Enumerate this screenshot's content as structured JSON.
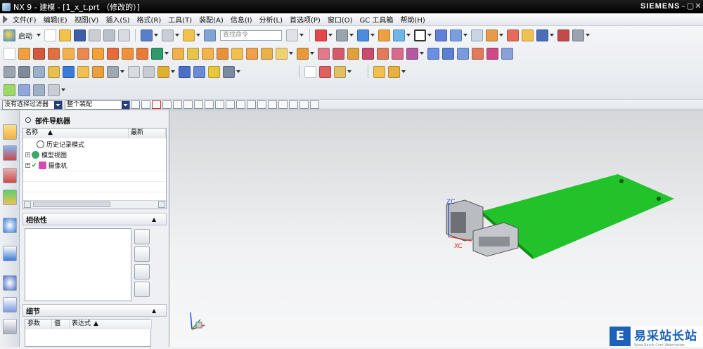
{
  "app": {
    "title": "NX 9 - 建模 - [1_x_t.prt （修改的）]",
    "brand": "SIEMENS",
    "window_buttons": [
      "–",
      "▢",
      "✕"
    ]
  },
  "menu": {
    "items": [
      "文件(F)",
      "编辑(E)",
      "视图(V)",
      "插入(S)",
      "格式(R)",
      "工具(T)",
      "装配(A)",
      "信息(I)",
      "分析(L)",
      "首选项(P)",
      "窗口(O)",
      "GC 工具箱",
      "帮助(H)"
    ]
  },
  "toolbar": {
    "start_label": "启动",
    "command_search_placeholder": "查找命令"
  },
  "filterbar": {
    "type_filter": "没有选择过滤器",
    "scope": "整个装配"
  },
  "navigator": {
    "title": "部件导航器",
    "col_name": "名称",
    "col_latest": "最新",
    "nodes": [
      "历史记录模式",
      "模型视图",
      "摄像机"
    ]
  },
  "dependencies": {
    "title": "相依性"
  },
  "details": {
    "title": "细节",
    "col_param": "参数",
    "col_value": "值",
    "col_expr": "表达式"
  },
  "viewport": {
    "zc_label": "ZC",
    "xc_label": "XC",
    "board_color": "#22c22a"
  },
  "watermark": {
    "logo_char": "E",
    "text": "易采站长站",
    "sub": "Www.Easck.Com  Webmaster"
  }
}
